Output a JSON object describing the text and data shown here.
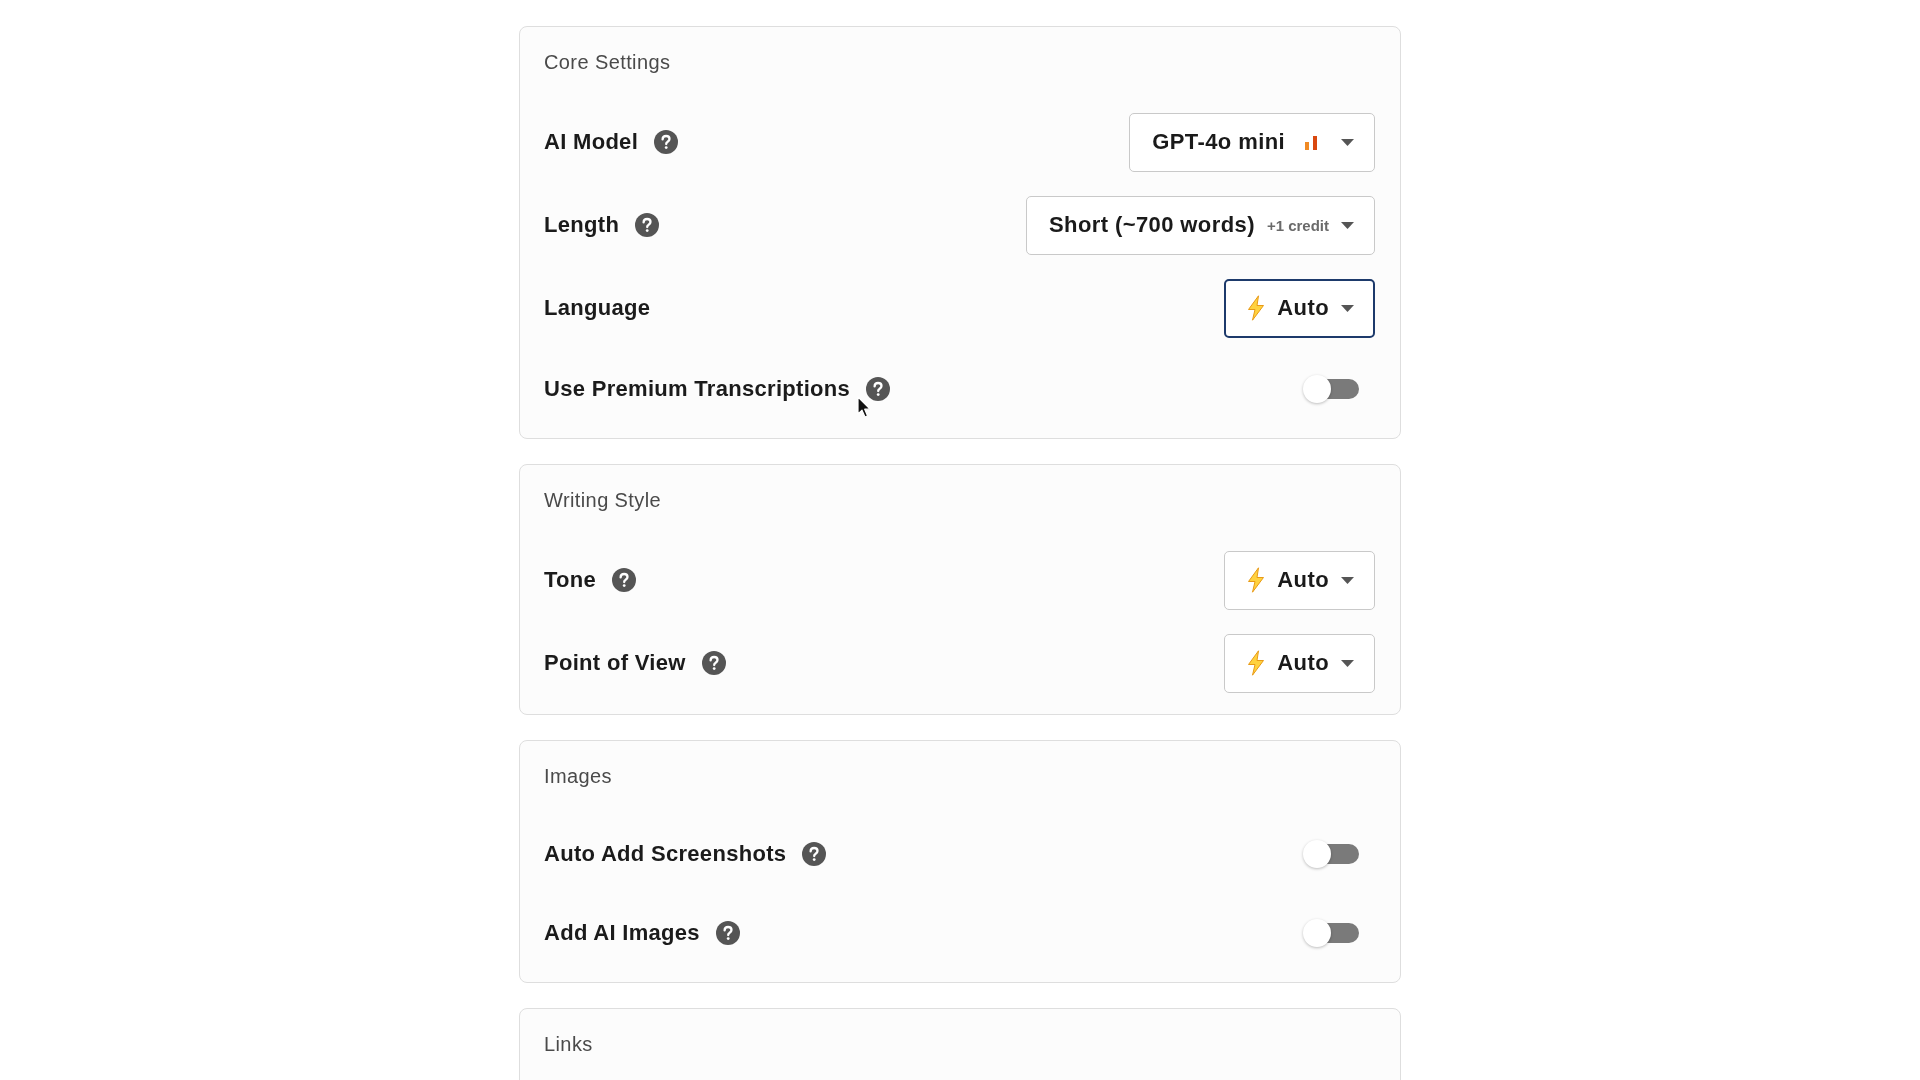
{
  "sections": [
    {
      "title": "Core Settings",
      "rows": [
        {
          "kind": "select",
          "label": "AI Model",
          "help": true,
          "select": {
            "kind": "model",
            "value": "GPT-4o mini",
            "focused": false
          }
        },
        {
          "kind": "select",
          "label": "Length",
          "help": true,
          "select": {
            "kind": "plain",
            "value": "Short (~700 words)",
            "note": "+1 credit",
            "focused": false
          }
        },
        {
          "kind": "select",
          "label": "Language",
          "help": false,
          "select": {
            "kind": "auto",
            "value": "Auto",
            "focused": true
          }
        },
        {
          "kind": "toggle",
          "label": "Use Premium Transcriptions",
          "help": true,
          "on": false
        }
      ]
    },
    {
      "title": "Writing Style",
      "rows": [
        {
          "kind": "select",
          "label": "Tone",
          "help": true,
          "select": {
            "kind": "auto",
            "value": "Auto",
            "focused": false
          }
        },
        {
          "kind": "select",
          "label": "Point of View",
          "help": true,
          "select": {
            "kind": "auto",
            "value": "Auto",
            "focused": false
          }
        }
      ]
    },
    {
      "title": "Images",
      "rows": [
        {
          "kind": "toggle",
          "label": "Auto Add Screenshots",
          "help": true,
          "on": false
        },
        {
          "kind": "toggle",
          "label": "Add AI Images",
          "help": true,
          "on": false
        }
      ]
    },
    {
      "title": "Links"
    }
  ]
}
